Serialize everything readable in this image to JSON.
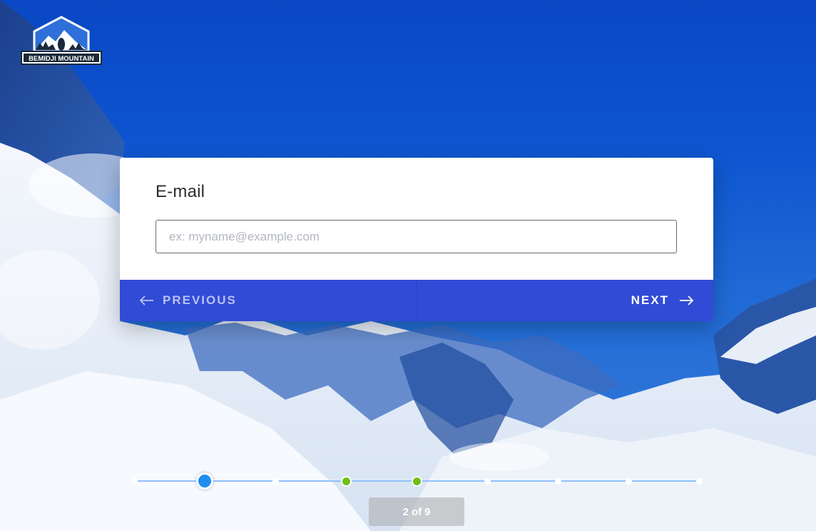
{
  "logo": {
    "text": "BEMIDJI MOUNTAIN",
    "icon": "mountain-badge-icon"
  },
  "question": {
    "label": "E-mail",
    "placeholder": "ex: myname@example.com",
    "value": ""
  },
  "navigation": {
    "previous_label": "PREVIOUS",
    "next_label": "NEXT",
    "previous_icon": "arrow-left-icon",
    "next_icon": "arrow-right-icon"
  },
  "progress": {
    "current": "2",
    "of_label": "of",
    "total": "9",
    "steps": [
      "upcoming",
      "current",
      "upcoming",
      "done",
      "done",
      "upcoming",
      "upcoming",
      "upcoming",
      "upcoming"
    ]
  },
  "colors": {
    "nav_bar": "#314bd6",
    "current_step": "#1f8ef0",
    "done_step": "#6fbf14",
    "track": "#8fc1ff"
  }
}
